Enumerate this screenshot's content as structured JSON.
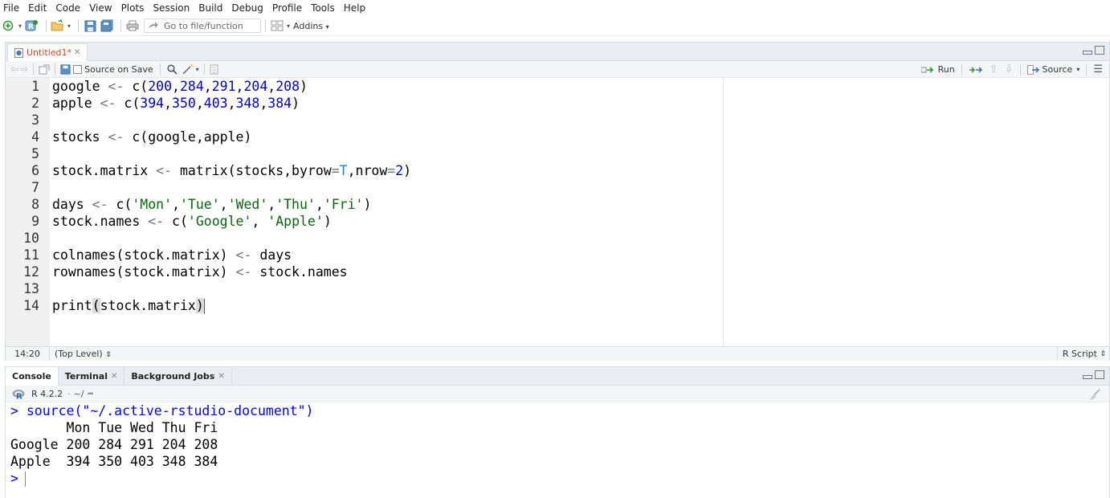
{
  "menu": [
    "File",
    "Edit",
    "Code",
    "View",
    "Plots",
    "Session",
    "Build",
    "Debug",
    "Profile",
    "Tools",
    "Help"
  ],
  "toolbar": {
    "goto_placeholder": "Go to file/function",
    "addins_label": "Addins"
  },
  "editor": {
    "tab_name": "Untitled1*",
    "source_on_save_label": "Source on Save",
    "run_label": "Run",
    "source_label": "Source",
    "status": {
      "cursor_position": "14:20",
      "scope": "(Top Level)",
      "file_type": "R Script"
    },
    "lines": [
      {
        "num": "1",
        "code": "google <- c(200,284,291,204,208)"
      },
      {
        "num": "2",
        "code": "apple <- c(394,350,403,348,384)"
      },
      {
        "num": "3",
        "code": ""
      },
      {
        "num": "4",
        "code": "stocks <- c(google,apple)"
      },
      {
        "num": "5",
        "code": ""
      },
      {
        "num": "6",
        "code": "stock.matrix <- matrix(stocks,byrow=T,nrow=2)"
      },
      {
        "num": "7",
        "code": ""
      },
      {
        "num": "8",
        "code": "days <- c('Mon','Tue','Wed','Thu','Fri')"
      },
      {
        "num": "9",
        "code": "stock.names <- c('Google', 'Apple')"
      },
      {
        "num": "10",
        "code": ""
      },
      {
        "num": "11",
        "code": "colnames(stock.matrix) <- days"
      },
      {
        "num": "12",
        "code": "rownames(stock.matrix) <- stock.names"
      },
      {
        "num": "13",
        "code": ""
      },
      {
        "num": "14",
        "code": "print(stock.matrix)"
      }
    ]
  },
  "console": {
    "tabs": [
      "Console",
      "Terminal",
      "Background Jobs"
    ],
    "r_version": "R 4.2.2",
    "working_dir": "~/",
    "command": "> source(\"~/.active-rstudio-document\")",
    "output": [
      "       Mon Tue Wed Thu Fri",
      "Google 200 284 291 204 208",
      "Apple  394 350 403 348 384"
    ],
    "prompt": ">"
  },
  "colors": {
    "number": "#0000cd",
    "string": "#036a07",
    "literal": "#0088ff",
    "console_command": "#0000ff",
    "pane_header": "#e9edf1"
  }
}
